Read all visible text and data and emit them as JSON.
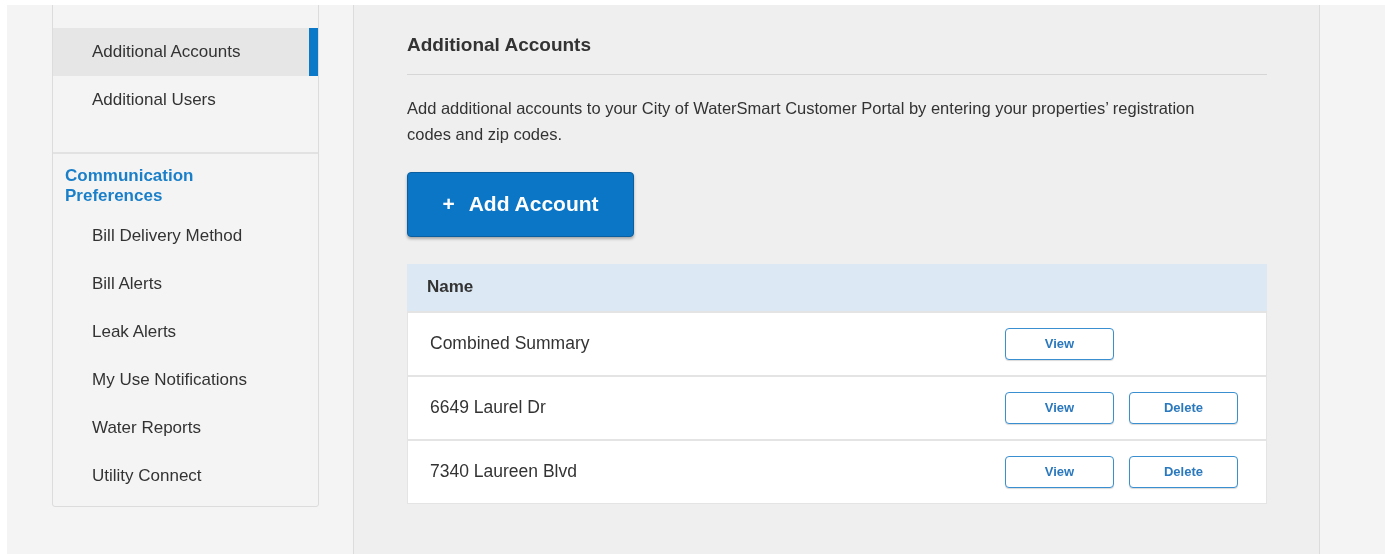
{
  "sidebar": {
    "groups": [
      {
        "items": [
          {
            "label": "Additional Accounts",
            "selected": true
          },
          {
            "label": "Additional Users",
            "selected": false
          }
        ]
      },
      {
        "heading": "Communication Preferences",
        "items": [
          {
            "label": "Bill Delivery Method",
            "selected": false
          },
          {
            "label": "Bill Alerts",
            "selected": false
          },
          {
            "label": "Leak Alerts",
            "selected": false
          },
          {
            "label": "My Use Notifications",
            "selected": false
          },
          {
            "label": "Water Reports",
            "selected": false
          },
          {
            "label": "Utility Connect",
            "selected": false
          }
        ]
      }
    ]
  },
  "main": {
    "title": "Additional Accounts",
    "description": "Add additional accounts to your City of WaterSmart Customer Portal by entering your properties’ registration codes and zip codes.",
    "add_button": {
      "icon": "+",
      "label": "Add Account"
    },
    "table": {
      "columns": [
        "Name"
      ],
      "rows": [
        {
          "name": "Combined Summary",
          "actions": [
            "View"
          ]
        },
        {
          "name": "6649 Laurel Dr",
          "actions": [
            "View",
            "Delete"
          ]
        },
        {
          "name": "7340 Laureen Blvd",
          "actions": [
            "View",
            "Delete"
          ]
        }
      ]
    }
  }
}
